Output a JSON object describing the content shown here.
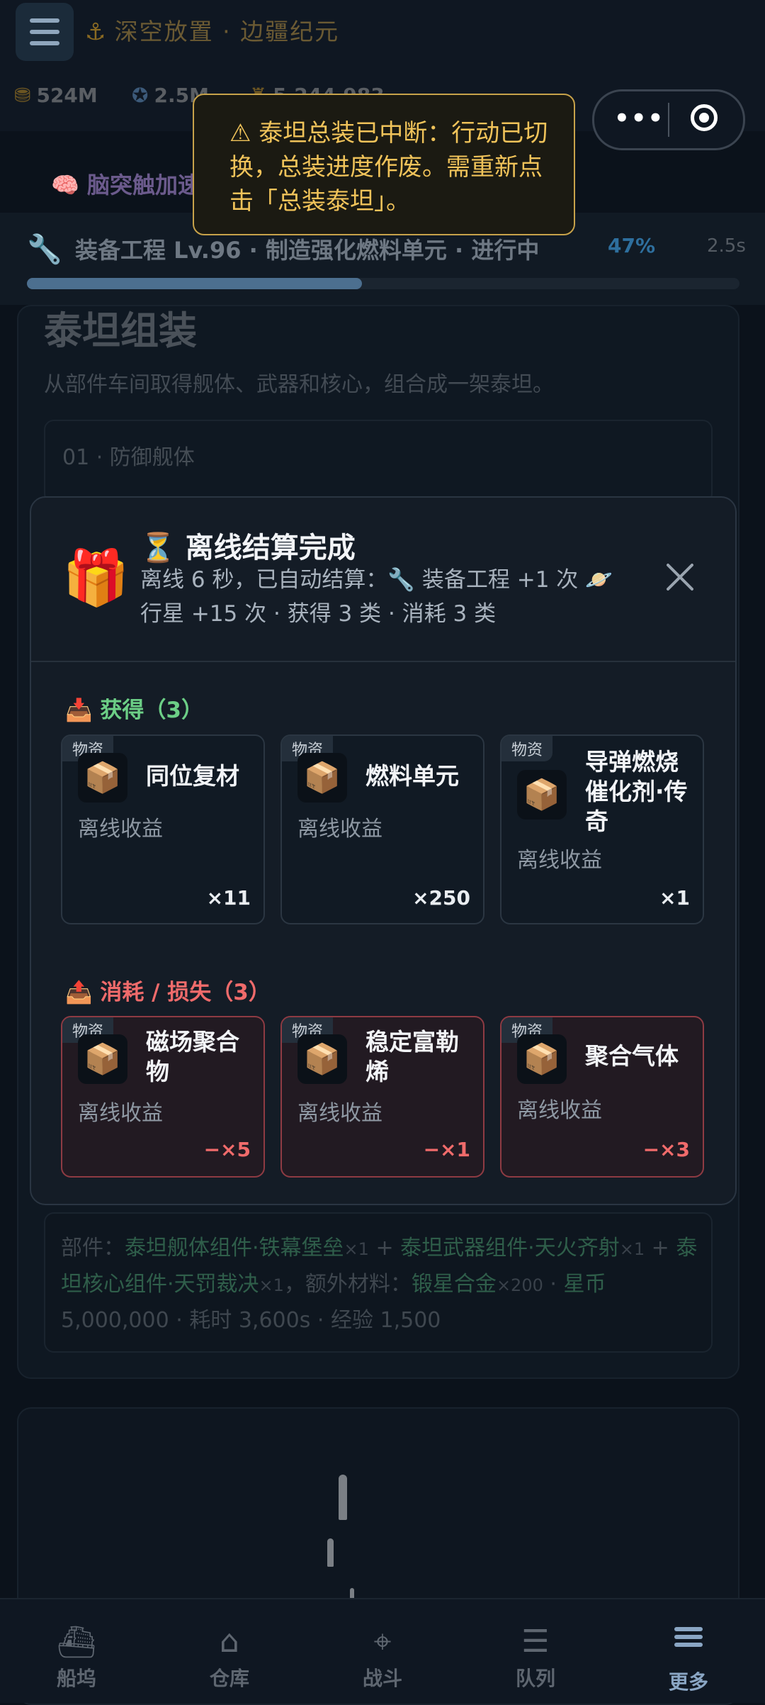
{
  "header": {
    "title": "深空放置 · 边疆纪元",
    "resources": [
      {
        "icon": "coins-icon",
        "value": "524M"
      },
      {
        "icon": "medal-icon",
        "value": "2.5M"
      },
      {
        "icon": "rank-icon",
        "value": "5,244,983"
      }
    ],
    "capsule": {
      "more_label": "•••"
    }
  },
  "boost": {
    "label": "脑突触加速"
  },
  "production": {
    "text": "装备工程 Lv.96 · 制造强化燃料单元 · 进行中",
    "percent": "47%",
    "progress": 0.47,
    "time": "2.5s"
  },
  "toast": {
    "text": "⚠ 泰坦总装已中断：行动已切换，总装进度作废。需重新点击「总装泰坦」。"
  },
  "background_page": {
    "title": "泰坦组装",
    "description": "从部件车间取得舰体、武器和核心，组合成一架泰坦。",
    "slot_label": "01 · 防御舰体",
    "parts": {
      "prefix": "部件：",
      "part1": "泰坦舰体组件·铁幕堡垒",
      "part1_qty": "×1",
      "plus1": " + ",
      "part2": "泰坦武器组件·天火齐射",
      "part2_qty": "×1",
      "plus2": " + ",
      "part3": "泰坦核心组件·天罚裁决",
      "part3_qty": "×1",
      "extra_prefix": "，额外材料：",
      "extra": "锻星合金",
      "extra_qty": "×200",
      "sep": " · ",
      "coin_label": "星币",
      "coin_value": "5,000,000",
      "time": " · 耗时 3,600s · 经验 1,500"
    }
  },
  "modal": {
    "gift_icon": "🎁",
    "title": "⏳ 离线结算完成",
    "subtitle": "离线 6 秒，已自动结算：🔧 装备工程 +1 次 🪐 行星 +15 次 · 获得 3 类 · 消耗 3 类",
    "gain_title": "📥 获得（3）",
    "loss_title": "📤 消耗 / 损失（3）",
    "gains": [
      {
        "tag": "物资",
        "icon": "📦",
        "name": "同位复材",
        "source": "离线收益",
        "qty": "×11"
      },
      {
        "tag": "物资",
        "icon": "📦",
        "name": "燃料单元",
        "source": "离线收益",
        "qty": "×250"
      },
      {
        "tag": "物资",
        "icon": "📦",
        "name": "导弹燃烧催化剂·传奇",
        "source": "离线收益",
        "qty": "×1"
      }
    ],
    "losses": [
      {
        "tag": "物资",
        "icon": "📦",
        "name": "磁场聚合物",
        "source": "离线收益",
        "qty": "−×5"
      },
      {
        "tag": "物资",
        "icon": "📦",
        "name": "稳定富勒烯",
        "source": "离线收益",
        "qty": "−×1"
      },
      {
        "tag": "物资",
        "icon": "📦",
        "name": "聚合气体",
        "source": "离线收益",
        "qty": "−×3"
      }
    ]
  },
  "nav": [
    {
      "label": "船坞",
      "icon": "ship-icon"
    },
    {
      "label": "仓库",
      "icon": "warehouse-icon"
    },
    {
      "label": "战斗",
      "icon": "crosshair-icon"
    },
    {
      "label": "队列",
      "icon": "queue-icon"
    },
    {
      "label": "更多",
      "icon": "menu-icon"
    }
  ],
  "colors": {
    "accent_gold": "#f0c35a",
    "gain_green": "#6ccf86",
    "loss_red": "#f06b6b",
    "nav_active": "#8aa6c4"
  }
}
